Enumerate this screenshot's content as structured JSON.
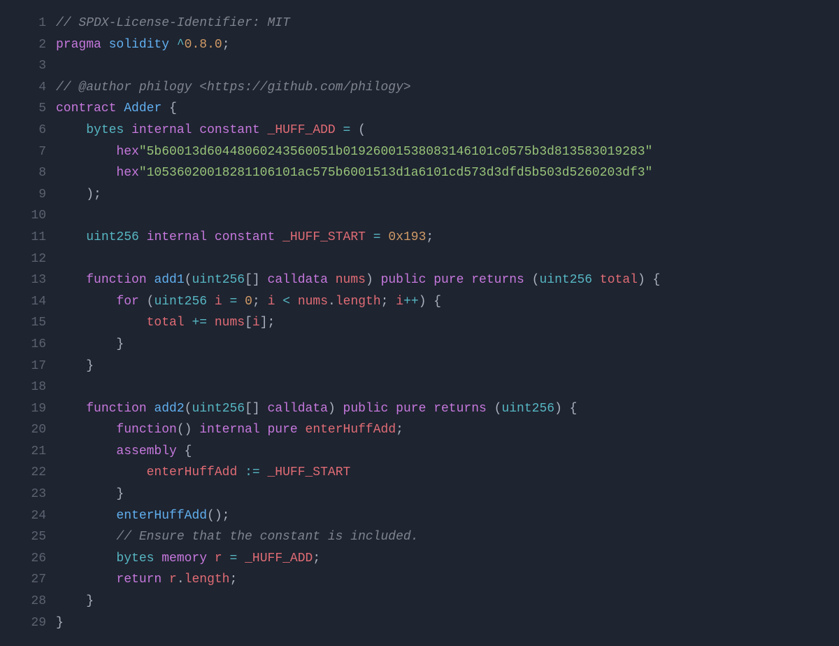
{
  "colors": {
    "background": "#1e2430",
    "comment": "#7f848e",
    "keyword": "#c678dd",
    "type": "#56b6c2",
    "const": "#e06c75",
    "ident": "#61afef",
    "number": "#d19a66",
    "string": "#98c379",
    "punct": "#abb2bf",
    "lineno": "#5c6370"
  },
  "lines": [
    {
      "n": "1",
      "tokens": [
        {
          "cls": "comment",
          "text": "// SPDX-License-Identifier: MIT"
        }
      ]
    },
    {
      "n": "2",
      "tokens": [
        {
          "cls": "keyword",
          "text": "pragma"
        },
        {
          "cls": "plain",
          "text": " "
        },
        {
          "cls": "ident",
          "text": "solidity"
        },
        {
          "cls": "plain",
          "text": " "
        },
        {
          "cls": "op",
          "text": "^"
        },
        {
          "cls": "number",
          "text": "0.8.0"
        },
        {
          "cls": "punct",
          "text": ";"
        }
      ]
    },
    {
      "n": "3",
      "tokens": []
    },
    {
      "n": "4",
      "tokens": [
        {
          "cls": "comment",
          "text": "// @author philogy <https://github.com/philogy>"
        }
      ]
    },
    {
      "n": "5",
      "tokens": [
        {
          "cls": "keyword",
          "text": "contract"
        },
        {
          "cls": "plain",
          "text": " "
        },
        {
          "cls": "ident",
          "text": "Adder"
        },
        {
          "cls": "plain",
          "text": " "
        },
        {
          "cls": "punct",
          "text": "{"
        }
      ]
    },
    {
      "n": "6",
      "tokens": [
        {
          "cls": "plain",
          "text": "    "
        },
        {
          "cls": "typename",
          "text": "bytes"
        },
        {
          "cls": "plain",
          "text": " "
        },
        {
          "cls": "keyword",
          "text": "internal"
        },
        {
          "cls": "plain",
          "text": " "
        },
        {
          "cls": "keyword",
          "text": "constant"
        },
        {
          "cls": "plain",
          "text": " "
        },
        {
          "cls": "const",
          "text": "_HUFF_ADD"
        },
        {
          "cls": "plain",
          "text": " "
        },
        {
          "cls": "op",
          "text": "="
        },
        {
          "cls": "plain",
          "text": " "
        },
        {
          "cls": "punct",
          "text": "("
        }
      ]
    },
    {
      "n": "7",
      "tokens": [
        {
          "cls": "plain",
          "text": "        "
        },
        {
          "cls": "keyword",
          "text": "hex"
        },
        {
          "cls": "string",
          "text": "\"5b60013d60448060243560051b01926001538083146101c0575b3d813583019283\""
        }
      ]
    },
    {
      "n": "8",
      "tokens": [
        {
          "cls": "plain",
          "text": "        "
        },
        {
          "cls": "keyword",
          "text": "hex"
        },
        {
          "cls": "string",
          "text": "\"105360200182811061​01ac575b6001513d1a6101cd573d3dfd5b503d5260203df3\""
        }
      ]
    },
    {
      "n": "9",
      "tokens": [
        {
          "cls": "plain",
          "text": "    "
        },
        {
          "cls": "punct",
          "text": ");"
        }
      ]
    },
    {
      "n": "10",
      "tokens": []
    },
    {
      "n": "11",
      "tokens": [
        {
          "cls": "plain",
          "text": "    "
        },
        {
          "cls": "typename",
          "text": "uint256"
        },
        {
          "cls": "plain",
          "text": " "
        },
        {
          "cls": "keyword",
          "text": "internal"
        },
        {
          "cls": "plain",
          "text": " "
        },
        {
          "cls": "keyword",
          "text": "constant"
        },
        {
          "cls": "plain",
          "text": " "
        },
        {
          "cls": "const",
          "text": "_HUFF_START"
        },
        {
          "cls": "plain",
          "text": " "
        },
        {
          "cls": "op",
          "text": "="
        },
        {
          "cls": "plain",
          "text": " "
        },
        {
          "cls": "number",
          "text": "0x193"
        },
        {
          "cls": "punct",
          "text": ";"
        }
      ]
    },
    {
      "n": "12",
      "tokens": []
    },
    {
      "n": "13",
      "tokens": [
        {
          "cls": "plain",
          "text": "    "
        },
        {
          "cls": "keyword",
          "text": "function"
        },
        {
          "cls": "plain",
          "text": " "
        },
        {
          "cls": "funcname",
          "text": "add1"
        },
        {
          "cls": "punct",
          "text": "("
        },
        {
          "cls": "typename",
          "text": "uint256"
        },
        {
          "cls": "punct",
          "text": "[] "
        },
        {
          "cls": "keyword",
          "text": "calldata"
        },
        {
          "cls": "plain",
          "text": " "
        },
        {
          "cls": "var",
          "text": "nums"
        },
        {
          "cls": "punct",
          "text": ") "
        },
        {
          "cls": "keyword",
          "text": "public"
        },
        {
          "cls": "plain",
          "text": " "
        },
        {
          "cls": "keyword",
          "text": "pure"
        },
        {
          "cls": "plain",
          "text": " "
        },
        {
          "cls": "keyword",
          "text": "returns"
        },
        {
          "cls": "plain",
          "text": " "
        },
        {
          "cls": "punct",
          "text": "("
        },
        {
          "cls": "typename",
          "text": "uint256"
        },
        {
          "cls": "plain",
          "text": " "
        },
        {
          "cls": "var",
          "text": "total"
        },
        {
          "cls": "punct",
          "text": ") {"
        }
      ]
    },
    {
      "n": "14",
      "tokens": [
        {
          "cls": "plain",
          "text": "        "
        },
        {
          "cls": "keyword",
          "text": "for"
        },
        {
          "cls": "plain",
          "text": " "
        },
        {
          "cls": "punct",
          "text": "("
        },
        {
          "cls": "typename",
          "text": "uint256"
        },
        {
          "cls": "plain",
          "text": " "
        },
        {
          "cls": "var",
          "text": "i"
        },
        {
          "cls": "plain",
          "text": " "
        },
        {
          "cls": "op",
          "text": "="
        },
        {
          "cls": "plain",
          "text": " "
        },
        {
          "cls": "number",
          "text": "0"
        },
        {
          "cls": "punct",
          "text": "; "
        },
        {
          "cls": "var",
          "text": "i"
        },
        {
          "cls": "plain",
          "text": " "
        },
        {
          "cls": "op",
          "text": "<"
        },
        {
          "cls": "plain",
          "text": " "
        },
        {
          "cls": "var",
          "text": "nums"
        },
        {
          "cls": "punct",
          "text": "."
        },
        {
          "cls": "attr",
          "text": "length"
        },
        {
          "cls": "punct",
          "text": "; "
        },
        {
          "cls": "var",
          "text": "i"
        },
        {
          "cls": "op",
          "text": "++"
        },
        {
          "cls": "punct",
          "text": ") {"
        }
      ]
    },
    {
      "n": "15",
      "tokens": [
        {
          "cls": "plain",
          "text": "            "
        },
        {
          "cls": "var",
          "text": "total"
        },
        {
          "cls": "plain",
          "text": " "
        },
        {
          "cls": "op",
          "text": "+="
        },
        {
          "cls": "plain",
          "text": " "
        },
        {
          "cls": "var",
          "text": "nums"
        },
        {
          "cls": "punct",
          "text": "["
        },
        {
          "cls": "var",
          "text": "i"
        },
        {
          "cls": "punct",
          "text": "];"
        }
      ]
    },
    {
      "n": "16",
      "tokens": [
        {
          "cls": "plain",
          "text": "        "
        },
        {
          "cls": "punct",
          "text": "}"
        }
      ]
    },
    {
      "n": "17",
      "tokens": [
        {
          "cls": "plain",
          "text": "    "
        },
        {
          "cls": "punct",
          "text": "}"
        }
      ]
    },
    {
      "n": "18",
      "tokens": []
    },
    {
      "n": "19",
      "tokens": [
        {
          "cls": "plain",
          "text": "    "
        },
        {
          "cls": "keyword",
          "text": "function"
        },
        {
          "cls": "plain",
          "text": " "
        },
        {
          "cls": "funcname",
          "text": "add2"
        },
        {
          "cls": "punct",
          "text": "("
        },
        {
          "cls": "typename",
          "text": "uint256"
        },
        {
          "cls": "punct",
          "text": "[] "
        },
        {
          "cls": "keyword",
          "text": "calldata"
        },
        {
          "cls": "punct",
          "text": ") "
        },
        {
          "cls": "keyword",
          "text": "public"
        },
        {
          "cls": "plain",
          "text": " "
        },
        {
          "cls": "keyword",
          "text": "pure"
        },
        {
          "cls": "plain",
          "text": " "
        },
        {
          "cls": "keyword",
          "text": "returns"
        },
        {
          "cls": "plain",
          "text": " "
        },
        {
          "cls": "punct",
          "text": "("
        },
        {
          "cls": "typename",
          "text": "uint256"
        },
        {
          "cls": "punct",
          "text": ") {"
        }
      ]
    },
    {
      "n": "20",
      "tokens": [
        {
          "cls": "plain",
          "text": "        "
        },
        {
          "cls": "keyword",
          "text": "function"
        },
        {
          "cls": "punct",
          "text": "() "
        },
        {
          "cls": "keyword",
          "text": "internal"
        },
        {
          "cls": "plain",
          "text": " "
        },
        {
          "cls": "keyword",
          "text": "pure"
        },
        {
          "cls": "plain",
          "text": " "
        },
        {
          "cls": "var",
          "text": "enterHuffAdd"
        },
        {
          "cls": "punct",
          "text": ";"
        }
      ]
    },
    {
      "n": "21",
      "tokens": [
        {
          "cls": "plain",
          "text": "        "
        },
        {
          "cls": "keyword",
          "text": "assembly"
        },
        {
          "cls": "plain",
          "text": " "
        },
        {
          "cls": "punct",
          "text": "{"
        }
      ]
    },
    {
      "n": "22",
      "tokens": [
        {
          "cls": "plain",
          "text": "            "
        },
        {
          "cls": "var",
          "text": "enterHuffAdd"
        },
        {
          "cls": "plain",
          "text": " "
        },
        {
          "cls": "op",
          "text": ":="
        },
        {
          "cls": "plain",
          "text": " "
        },
        {
          "cls": "const",
          "text": "_HUFF_START"
        }
      ]
    },
    {
      "n": "23",
      "tokens": [
        {
          "cls": "plain",
          "text": "        "
        },
        {
          "cls": "punct",
          "text": "}"
        }
      ]
    },
    {
      "n": "24",
      "tokens": [
        {
          "cls": "plain",
          "text": "        "
        },
        {
          "cls": "funcname",
          "text": "enterHuffAdd"
        },
        {
          "cls": "punct",
          "text": "();"
        }
      ]
    },
    {
      "n": "25",
      "tokens": [
        {
          "cls": "plain",
          "text": "        "
        },
        {
          "cls": "comment",
          "text": "// Ensure that the constant is included."
        }
      ]
    },
    {
      "n": "26",
      "tokens": [
        {
          "cls": "plain",
          "text": "        "
        },
        {
          "cls": "typename",
          "text": "bytes"
        },
        {
          "cls": "plain",
          "text": " "
        },
        {
          "cls": "keyword",
          "text": "memory"
        },
        {
          "cls": "plain",
          "text": " "
        },
        {
          "cls": "var",
          "text": "r"
        },
        {
          "cls": "plain",
          "text": " "
        },
        {
          "cls": "op",
          "text": "="
        },
        {
          "cls": "plain",
          "text": " "
        },
        {
          "cls": "const",
          "text": "_HUFF_ADD"
        },
        {
          "cls": "punct",
          "text": ";"
        }
      ]
    },
    {
      "n": "27",
      "tokens": [
        {
          "cls": "plain",
          "text": "        "
        },
        {
          "cls": "keyword",
          "text": "return"
        },
        {
          "cls": "plain",
          "text": " "
        },
        {
          "cls": "var",
          "text": "r"
        },
        {
          "cls": "punct",
          "text": "."
        },
        {
          "cls": "attr",
          "text": "length"
        },
        {
          "cls": "punct",
          "text": ";"
        }
      ]
    },
    {
      "n": "28",
      "tokens": [
        {
          "cls": "plain",
          "text": "    "
        },
        {
          "cls": "punct",
          "text": "}"
        }
      ]
    },
    {
      "n": "29",
      "tokens": [
        {
          "cls": "punct",
          "text": "}"
        }
      ]
    }
  ]
}
